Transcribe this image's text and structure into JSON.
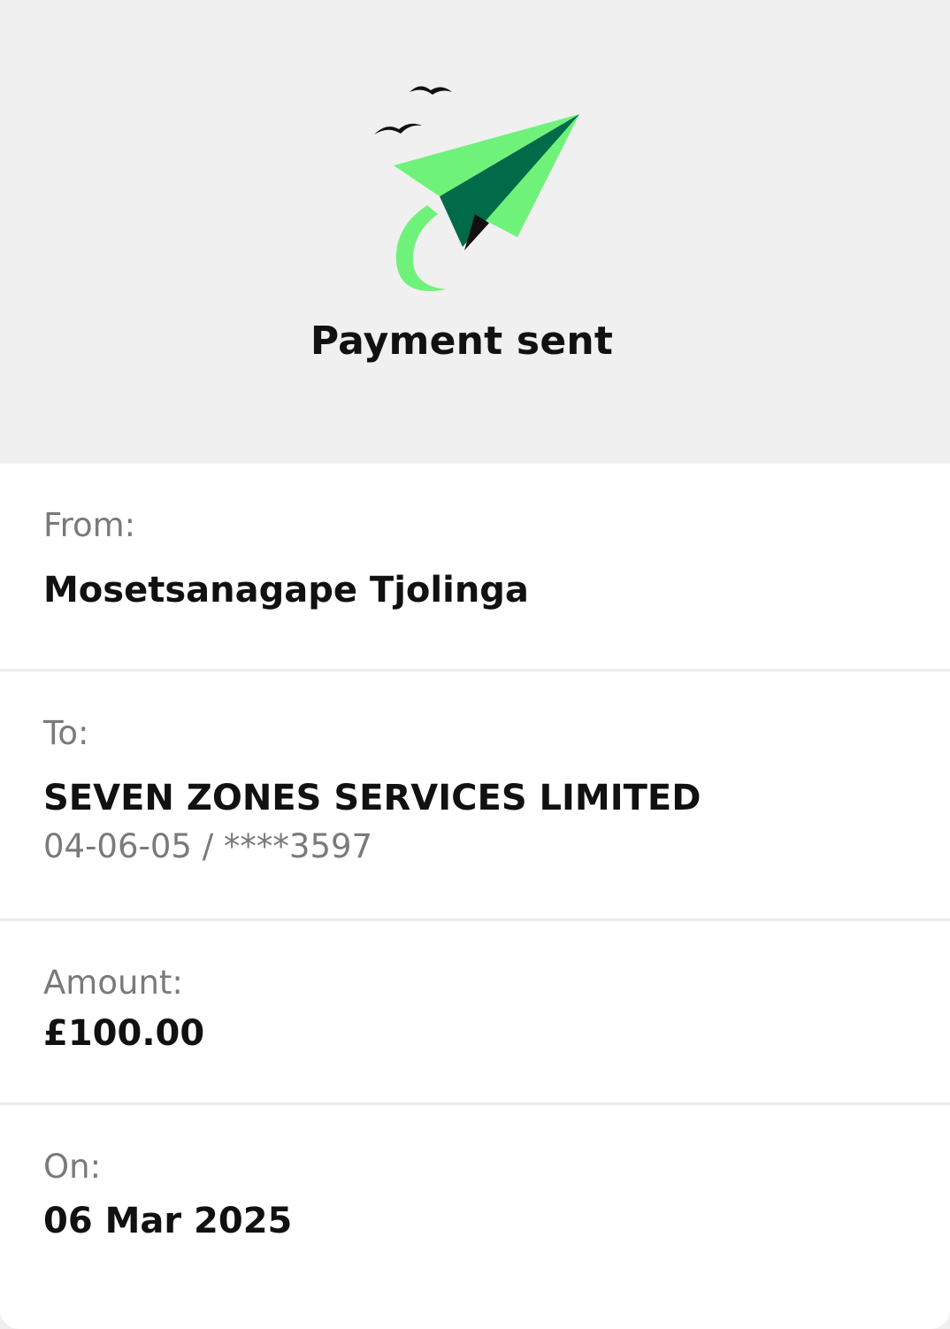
{
  "header": {
    "title": "Payment sent",
    "illustration": "paper-plane-with-birds",
    "colors": {
      "background": "#f0f0f0",
      "plane_light": "#6ff27a",
      "plane_dark": "#006a49",
      "plane_shadow": "#111111"
    }
  },
  "details": {
    "from": {
      "label": "From:",
      "value": "Mosetsanagape Tjolinga"
    },
    "to": {
      "label": "To:",
      "value": "SEVEN ZONES SERVICES LIMITED",
      "account": "04-06-05 / ****3597"
    },
    "amount": {
      "label": "Amount:",
      "value": "£100.00"
    },
    "on": {
      "label": "On:",
      "value": "06 Mar 2025"
    }
  }
}
